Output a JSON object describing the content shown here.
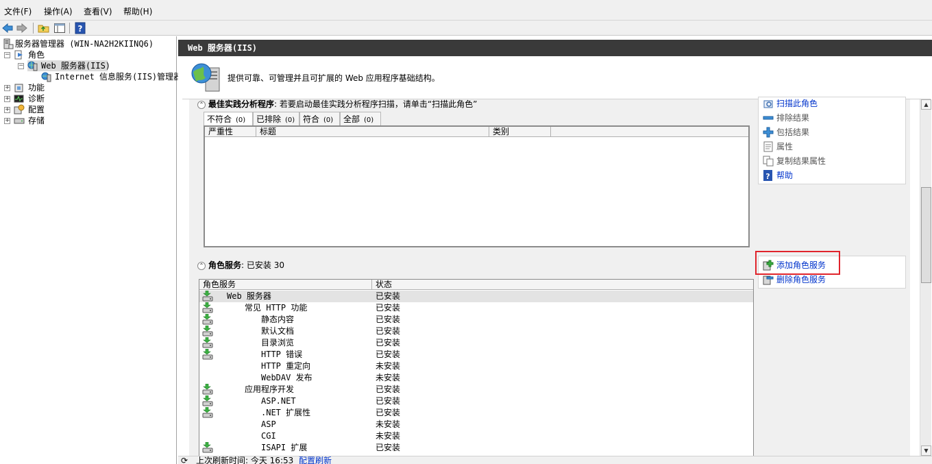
{
  "menu": [
    "文件(F)",
    "操作(A)",
    "查看(V)",
    "帮助(H)"
  ],
  "toolbar": {
    "back": "back-icon",
    "forward": "forward-icon",
    "up": "folder-up-icon",
    "show_hide": "console-tree-icon",
    "help": "help-icon"
  },
  "tree": {
    "root": "服务器管理器 (WIN-NA2H2KIINQ6)",
    "roles": "角色",
    "web_server": "Web 服务器(IIS)",
    "iis_manager": "Internet 信息服务(IIS)管理器",
    "features": "功能",
    "diagnostics": "诊断",
    "configuration": "配置",
    "storage": "存储"
  },
  "header": {
    "title": "Web 服务器(IIS)"
  },
  "banner": {
    "description": "提供可靠、可管理并且可扩展的 Web 应用程序基础结构。"
  },
  "bpa": {
    "title": "最佳实践分析程序",
    "subtitle": ": 若要启动最佳实践分析程序扫描，请单击“扫描此角色”",
    "tabs": [
      {
        "label": "不符合",
        "count": "(0)"
      },
      {
        "label": "已排除",
        "count": "(0)"
      },
      {
        "label": "符合",
        "count": "(0)"
      },
      {
        "label": "全部",
        "count": "(0)"
      }
    ],
    "columns": [
      "严重性",
      "标题",
      "类别"
    ],
    "actions": [
      {
        "label": "扫描此角色",
        "icon": "scan-icon"
      },
      {
        "label": "排除结果",
        "icon": "exclude-icon"
      },
      {
        "label": "包括结果",
        "icon": "include-icon"
      },
      {
        "label": "属性",
        "icon": "properties-icon"
      },
      {
        "label": "复制结果属性",
        "icon": "copy-icon"
      },
      {
        "label": "帮助",
        "icon": "help-icon"
      }
    ]
  },
  "role_services": {
    "title": "角色服务",
    "installed_label": ": 已安装 30",
    "columns": [
      "角色服务",
      "状态"
    ],
    "rows": [
      {
        "name": "Web 服务器",
        "status": "已安装",
        "installed": true
      },
      {
        "name": "常见 HTTP 功能",
        "status": "已安装",
        "installed": true
      },
      {
        "name": "静态内容",
        "status": "已安装",
        "installed": true
      },
      {
        "name": "默认文档",
        "status": "已安装",
        "installed": true
      },
      {
        "name": "目录浏览",
        "status": "已安装",
        "installed": true
      },
      {
        "name": "HTTP 错误",
        "status": "已安装",
        "installed": true
      },
      {
        "name": "HTTP 重定向",
        "status": "未安装",
        "installed": false
      },
      {
        "name": "WebDAV 发布",
        "status": "未安装",
        "installed": false
      },
      {
        "name": "应用程序开发",
        "status": "已安装",
        "installed": true
      },
      {
        "name": "ASP.NET",
        "status": "已安装",
        "installed": true
      },
      {
        "name": ".NET 扩展性",
        "status": "已安装",
        "installed": true
      },
      {
        "name": "ASP",
        "status": "未安装",
        "installed": false
      },
      {
        "name": "CGI",
        "status": "未安装",
        "installed": false
      },
      {
        "name": "ISAPI 扩展",
        "status": "已安装",
        "installed": true
      }
    ],
    "actions": [
      {
        "label": "添加角色服务",
        "icon": "add-role-service-icon"
      },
      {
        "label": "删除角色服务",
        "icon": "remove-role-service-icon"
      }
    ]
  },
  "status_bar": {
    "last_refresh": "上次刷新时间: 今天 16:53",
    "configure_refresh": "配置刷新"
  },
  "colors": {
    "header_bg": "#3a3a3a",
    "link": "#0033cc",
    "highlight": "#e0232b",
    "selected_row": "#e3e3e3"
  }
}
